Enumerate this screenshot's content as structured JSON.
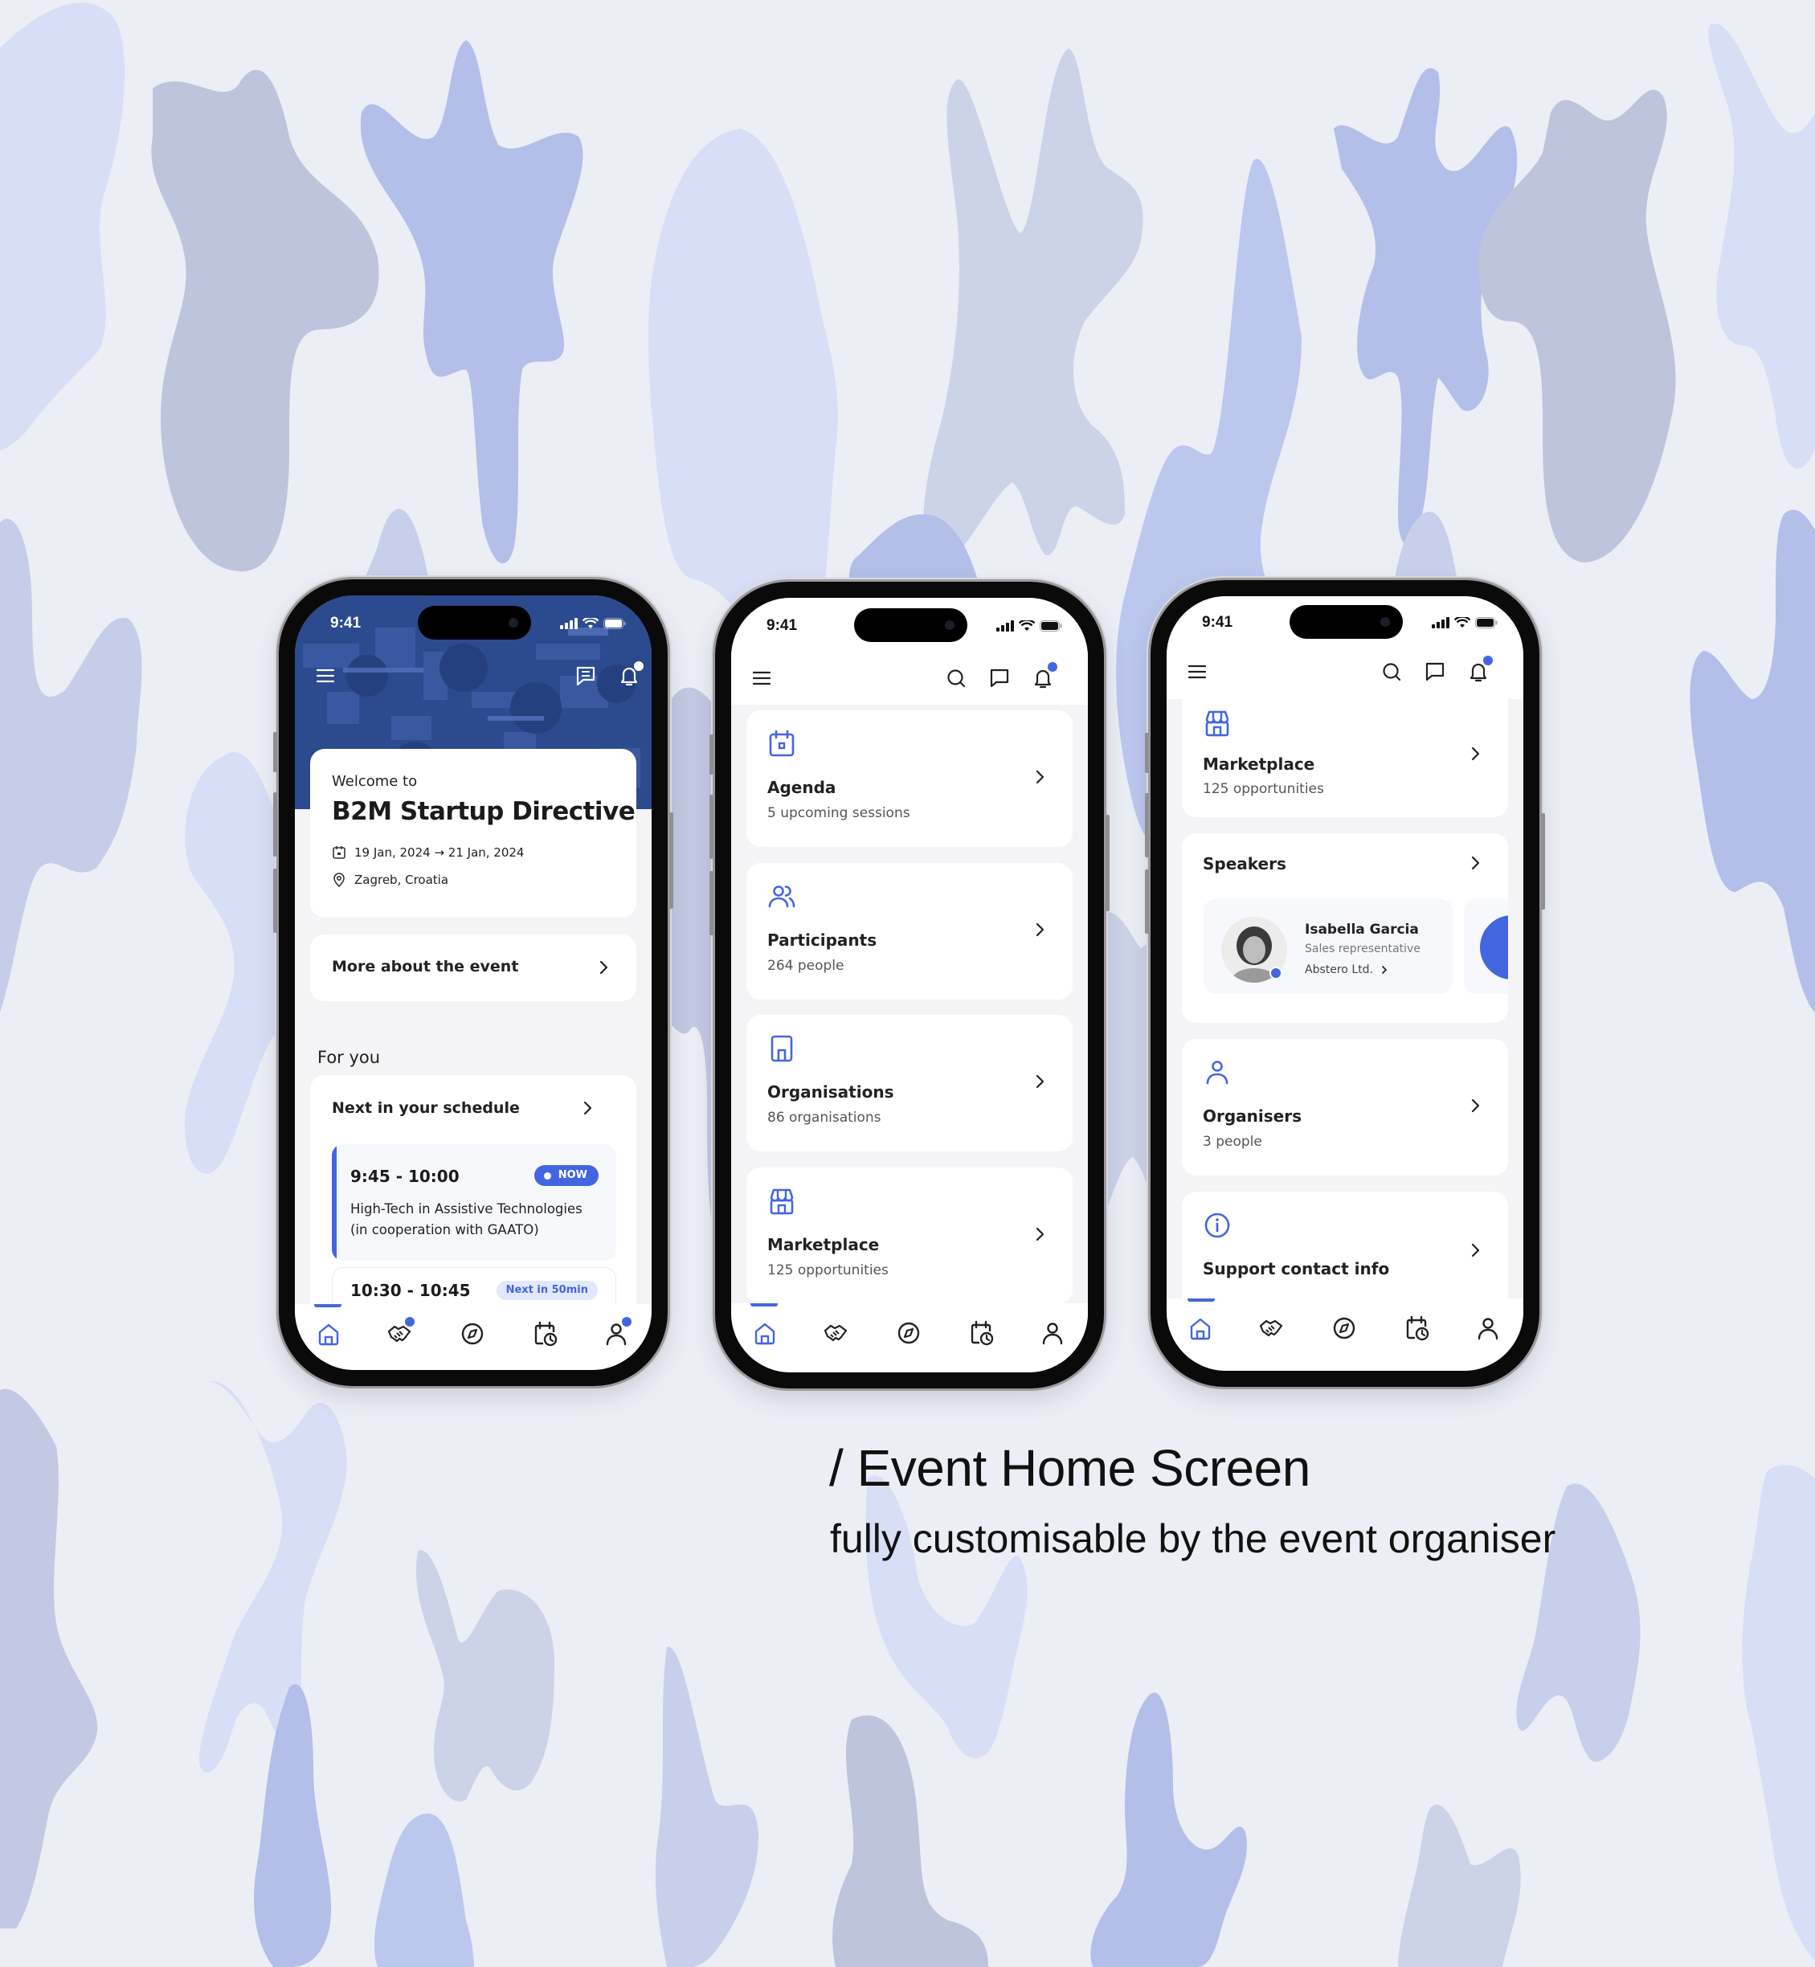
{
  "colors": {
    "background": "#eceef5",
    "accent": "#4366e0",
    "hero": "#2c4a8e",
    "blob_light": "#d8def6",
    "blob_mid": "#b3bfe8",
    "blob_gray": "#c3c9e2",
    "blob_slate": "#bec4dc"
  },
  "caption": {
    "title": "/ Event Home Screen",
    "subtitle": "fully customisable by the event organiser"
  },
  "status_bar": {
    "time": "9:41"
  },
  "nav_items": [
    {
      "name": "home",
      "icon": "home-icon",
      "active": true
    },
    {
      "name": "networking",
      "icon": "handshake-icon"
    },
    {
      "name": "explore",
      "icon": "compass-icon"
    },
    {
      "name": "schedule",
      "icon": "calendar-clock-icon"
    },
    {
      "name": "profile",
      "icon": "user-icon"
    }
  ],
  "phone1": {
    "welcome_label": "Welcome to",
    "event_title": "B2M Startup Directive",
    "dates": "19 Jan, 2024 → 21 Jan, 2024",
    "location": "Zagreb, Croatia",
    "more_about": "More about the event",
    "section_for_you": "For you",
    "schedule_title": "Next in your schedule",
    "sessions": [
      {
        "time": "9:45 - 10:00",
        "badge": "NOW",
        "title": "High-Tech in Assistive Technologies (in cooperation with GAATO)"
      },
      {
        "time": "10:30 - 10:45",
        "badge": "Next in 50min"
      }
    ]
  },
  "phone2": {
    "cards": [
      {
        "title": "Agenda",
        "subtitle": "5 upcoming sessions",
        "icon": "calendar-icon"
      },
      {
        "title": "Participants",
        "subtitle": "264 people",
        "icon": "users-icon"
      },
      {
        "title": "Organisations",
        "subtitle": "86 organisations",
        "icon": "building-icon"
      },
      {
        "title": "Marketplace",
        "subtitle": "125 opportunities",
        "icon": "store-icon"
      }
    ]
  },
  "phone3": {
    "marketplace": {
      "title": "Marketplace",
      "subtitle": "125 opportunities"
    },
    "speakers": {
      "title": "Speakers",
      "speaker": {
        "name": "Isabella Garcia",
        "role": "Sales representative",
        "company": "Abstero Ltd."
      }
    },
    "organisers": {
      "title": "Organisers",
      "subtitle": "3 people"
    },
    "support": {
      "title": "Support contact info"
    }
  }
}
